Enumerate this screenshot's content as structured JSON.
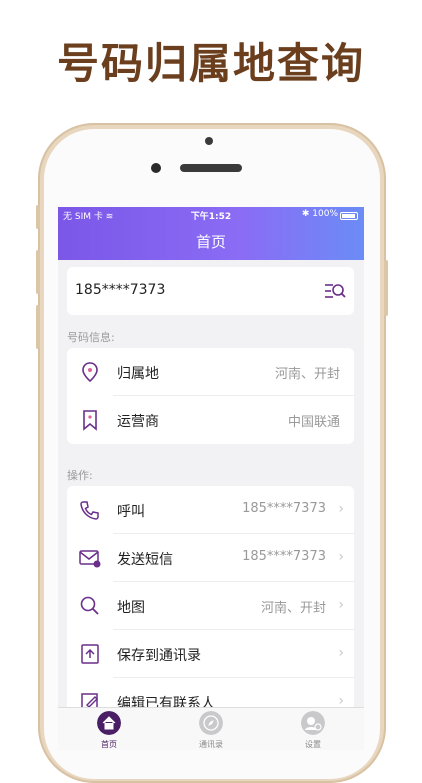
{
  "promo": {
    "headline": "号码归属地查询"
  },
  "status_bar": {
    "carrier": "无 SIM 卡",
    "time": "下午1:52",
    "battery": "100%"
  },
  "nav": {
    "title": "首页"
  },
  "search": {
    "value": "185****7373"
  },
  "info_section": {
    "label": "号码信息:",
    "rows": [
      {
        "label": "归属地",
        "value": "河南、开封",
        "icon": "location-pin-icon"
      },
      {
        "label": "运营商",
        "value": "中国联通",
        "icon": "bookmark-icon"
      }
    ]
  },
  "actions_section": {
    "label": "操作:",
    "rows": [
      {
        "label": "呼叫",
        "value": "185****7373",
        "icon": "phone-icon"
      },
      {
        "label": "发送短信",
        "value": "185****7373",
        "icon": "mail-icon"
      },
      {
        "label": "地图",
        "value": "河南、开封",
        "icon": "search-map-icon"
      },
      {
        "label": "保存到通讯录",
        "value": "",
        "icon": "save-contact-icon"
      },
      {
        "label": "编辑已有联系人",
        "value": "",
        "icon": "edit-icon"
      }
    ]
  },
  "tabs": [
    {
      "label": "首页",
      "icon": "home-icon",
      "active": true
    },
    {
      "label": "通讯录",
      "icon": "compass-icon",
      "active": false
    },
    {
      "label": "设置",
      "icon": "settings-icon",
      "active": false
    }
  ],
  "colors": {
    "accent": "#7b57e8",
    "headline": "#6b3f1e",
    "gold": "#e8d6bf"
  }
}
